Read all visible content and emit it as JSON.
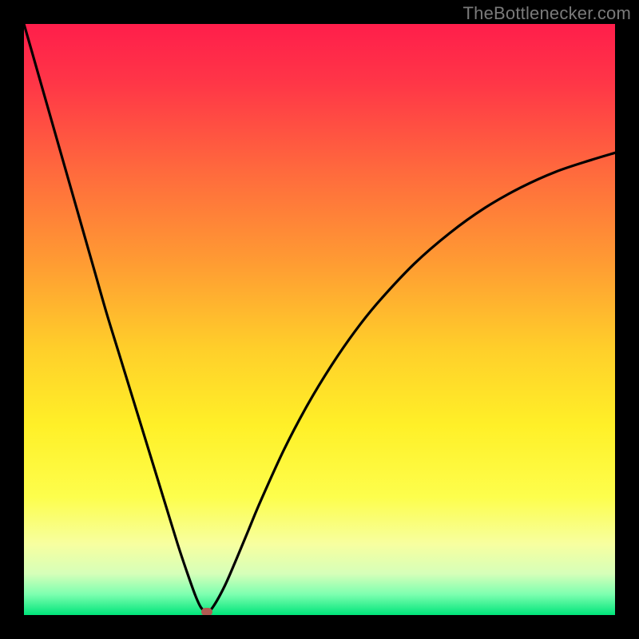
{
  "watermark": "TheBottlenecker.com",
  "chart_data": {
    "type": "line",
    "title": "",
    "xlabel": "",
    "ylabel": "",
    "xlim": [
      0,
      100
    ],
    "ylim": [
      0,
      100
    ],
    "grid": false,
    "background_gradient_stops": [
      {
        "offset": 0.0,
        "color": "#ff1e4b"
      },
      {
        "offset": 0.1,
        "color": "#ff3647"
      },
      {
        "offset": 0.25,
        "color": "#ff6a3d"
      },
      {
        "offset": 0.4,
        "color": "#ff9a33"
      },
      {
        "offset": 0.55,
        "color": "#ffcf2a"
      },
      {
        "offset": 0.68,
        "color": "#fff028"
      },
      {
        "offset": 0.8,
        "color": "#fdfe4c"
      },
      {
        "offset": 0.88,
        "color": "#f7ffa0"
      },
      {
        "offset": 0.93,
        "color": "#d6ffb9"
      },
      {
        "offset": 0.965,
        "color": "#7dffb0"
      },
      {
        "offset": 1.0,
        "color": "#00e57a"
      }
    ],
    "series": [
      {
        "name": "bottleneck-curve",
        "color": "#000000",
        "x": [
          0,
          2,
          4,
          6,
          8,
          10,
          12,
          14,
          16,
          18,
          20,
          22,
          24,
          26,
          27.5,
          29,
          30,
          31,
          32,
          34,
          36,
          38,
          40,
          44,
          48,
          52,
          56,
          60,
          66,
          72,
          78,
          84,
          90,
          96,
          100
        ],
        "y": [
          100,
          93,
          86,
          79,
          72,
          65,
          58,
          51,
          44.5,
          38,
          31.5,
          25,
          18.5,
          12,
          7.5,
          3.3,
          1.2,
          0.6,
          1.4,
          5.0,
          9.6,
          14.4,
          19.2,
          28.0,
          35.6,
          42.2,
          48.0,
          53.0,
          59.4,
          64.6,
          68.9,
          72.3,
          75.0,
          77.0,
          78.2
        ]
      }
    ],
    "marker": {
      "name": "min-point",
      "x": 31,
      "y": 0.6,
      "color": "#b15a52"
    }
  }
}
